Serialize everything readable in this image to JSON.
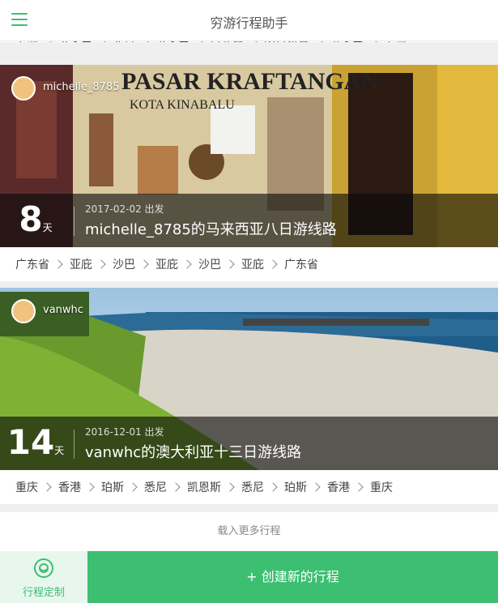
{
  "header": {
    "title": "穷游行程助手",
    "menu_icon": "hamburger-menu-icon"
  },
  "top_route": {
    "stops": [
      "上海",
      "苏禾巴",
      "北京",
      "苏禾巴",
      "卢塞恩",
      "因特拉肯",
      "苏禾巴",
      "上海"
    ]
  },
  "trips": [
    {
      "username": "michelle_8785",
      "days": "8",
      "days_unit": "天",
      "date": "2017-02-02 出发",
      "title": "michelle_8785的马来西亚八日游线路",
      "photo_sign": [
        "PASAR KRAFTANGAN",
        "KOTA KINABALU"
      ],
      "route": [
        "广东省",
        "亚庇",
        "沙巴",
        "亚庇",
        "沙巴",
        "亚庇",
        "广东省"
      ]
    },
    {
      "username": "vanwhc",
      "days": "14",
      "days_unit": "天",
      "date": "2016-12-01 出发",
      "title": "vanwhc的澳大利亚十三日游线路",
      "route": [
        "重庆",
        "香港",
        "珀斯",
        "悉尼",
        "凯恩斯",
        "悉尼",
        "珀斯",
        "香港",
        "重庆"
      ]
    }
  ],
  "load_more": "载入更多行程",
  "bottom": {
    "custom_label": "行程定制",
    "create_label": "+ 创建新的行程"
  },
  "colors": {
    "accent": "#3cbf70",
    "overlay": "#0a0a0a"
  }
}
